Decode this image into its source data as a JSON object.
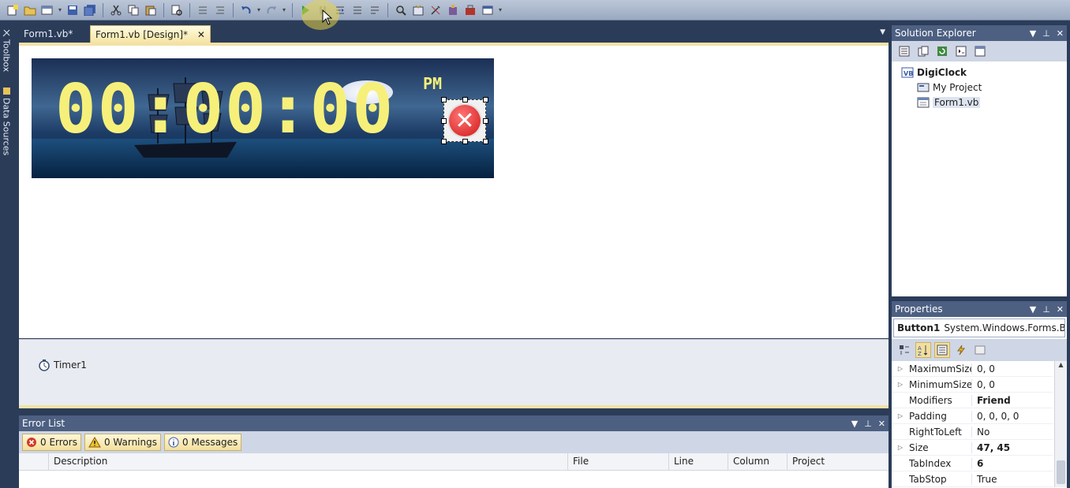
{
  "document_tabs": {
    "tab1": "Form1.vb*",
    "tab2": "Form1.vb [Design]*",
    "close": "✕"
  },
  "left_strip": {
    "toolbox": "Toolbox",
    "data_sources": "Data Sources"
  },
  "form": {
    "clock_text": "00:00:00",
    "ampm": "PM"
  },
  "tray": {
    "timer": "Timer1"
  },
  "error_list": {
    "title": "Error List",
    "errors": "0 Errors",
    "warnings": "0 Warnings",
    "messages": "0 Messages",
    "columns": [
      "Description",
      "File",
      "Line",
      "Column",
      "Project"
    ]
  },
  "solution_explorer": {
    "title": "Solution Explorer",
    "project": "DigiClock",
    "items": [
      "My Project",
      "Form1.vb"
    ]
  },
  "properties": {
    "title": "Properties",
    "object_name": "Button1",
    "object_type": "System.Windows.Forms.B",
    "rows": [
      {
        "name": "MaximumSize",
        "value": "0, 0",
        "expandable": true,
        "bold": false
      },
      {
        "name": "MinimumSize",
        "value": "0, 0",
        "expandable": true,
        "bold": false
      },
      {
        "name": "Modifiers",
        "value": "Friend",
        "expandable": false,
        "bold": true
      },
      {
        "name": "Padding",
        "value": "0, 0, 0, 0",
        "expandable": true,
        "bold": false
      },
      {
        "name": "RightToLeft",
        "value": "No",
        "expandable": false,
        "bold": false
      },
      {
        "name": "Size",
        "value": "47, 45",
        "expandable": true,
        "bold": true
      },
      {
        "name": "TabIndex",
        "value": "6",
        "expandable": false,
        "bold": true
      },
      {
        "name": "TabStop",
        "value": "True",
        "expandable": false,
        "bold": false
      }
    ]
  },
  "colors": {
    "accent": "#f2e2a6",
    "chrome": "#2b3c59",
    "panel_title": "#4d6082",
    "digit": "#f6f07a"
  }
}
